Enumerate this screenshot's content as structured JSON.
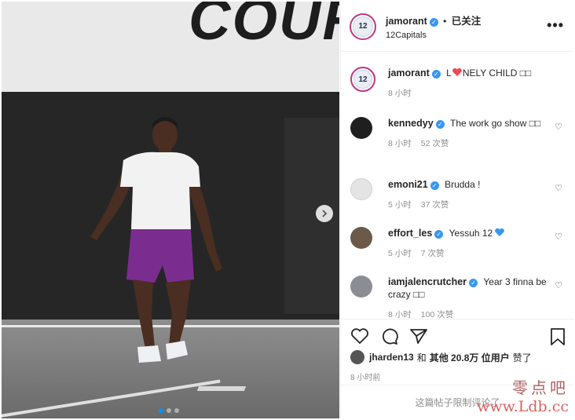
{
  "photo": {
    "wall_text": "COUR",
    "next_label": "›"
  },
  "post": {
    "author": "jamorant",
    "follow_sep": "•",
    "follow_label": "已关注",
    "location": "12Capitals",
    "more_label": "•••",
    "avatar_text": "12"
  },
  "caption": {
    "user": "jamorant",
    "text_pre": "L",
    "text_post": "NELY CHILD □□",
    "time": "8 小时"
  },
  "comments": [
    {
      "user": "kennedyy",
      "text": "The work go show □□",
      "time": "8 小时",
      "likes": "52 次赞"
    },
    {
      "user": "emoni21",
      "text": "Brudda !",
      "time": "5 小时",
      "likes": "37 次赞"
    },
    {
      "user": "effort_les",
      "text": "Yessuh 12",
      "time": "5 小时",
      "likes": "7 次赞"
    },
    {
      "user": "iamjalencrutcher",
      "text": "Year 3 finna be crazy □□",
      "time": "8 小时",
      "likes": "100 次赞"
    }
  ],
  "likes": {
    "user": "jharden13",
    "and": "和",
    "others": "其他 20.8万 位用户",
    "suffix": "赞了"
  },
  "time_ago": "8 小时前",
  "restricted_text": "这篇帖子限制评论了",
  "watermark": {
    "cn": "零点吧",
    "url": "www.Ldb.cc"
  },
  "colors": {
    "verified": "#3897f0",
    "heart_red": "#ed4956",
    "heart_blue": "#3897f0",
    "story_ring": "#c13584",
    "dot_active": "#0095f6"
  }
}
